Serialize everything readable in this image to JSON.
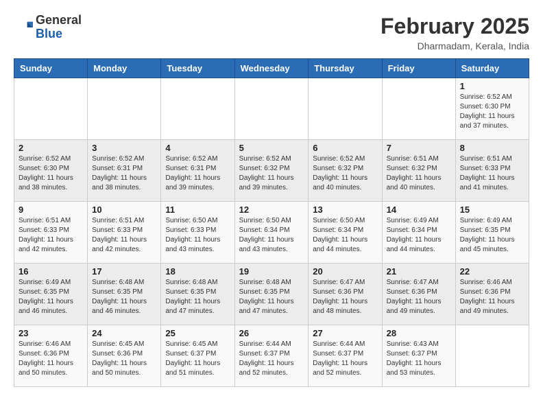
{
  "header": {
    "logo_general": "General",
    "logo_blue": "Blue",
    "month_year": "February 2025",
    "location": "Dharmadam, Kerala, India"
  },
  "days_of_week": [
    "Sunday",
    "Monday",
    "Tuesday",
    "Wednesday",
    "Thursday",
    "Friday",
    "Saturday"
  ],
  "weeks": [
    [
      {
        "day": "",
        "info": ""
      },
      {
        "day": "",
        "info": ""
      },
      {
        "day": "",
        "info": ""
      },
      {
        "day": "",
        "info": ""
      },
      {
        "day": "",
        "info": ""
      },
      {
        "day": "",
        "info": ""
      },
      {
        "day": "1",
        "info": "Sunrise: 6:52 AM\nSunset: 6:30 PM\nDaylight: 11 hours\nand 37 minutes."
      }
    ],
    [
      {
        "day": "2",
        "info": "Sunrise: 6:52 AM\nSunset: 6:30 PM\nDaylight: 11 hours\nand 38 minutes."
      },
      {
        "day": "3",
        "info": "Sunrise: 6:52 AM\nSunset: 6:31 PM\nDaylight: 11 hours\nand 38 minutes."
      },
      {
        "day": "4",
        "info": "Sunrise: 6:52 AM\nSunset: 6:31 PM\nDaylight: 11 hours\nand 39 minutes."
      },
      {
        "day": "5",
        "info": "Sunrise: 6:52 AM\nSunset: 6:32 PM\nDaylight: 11 hours\nand 39 minutes."
      },
      {
        "day": "6",
        "info": "Sunrise: 6:52 AM\nSunset: 6:32 PM\nDaylight: 11 hours\nand 40 minutes."
      },
      {
        "day": "7",
        "info": "Sunrise: 6:51 AM\nSunset: 6:32 PM\nDaylight: 11 hours\nand 40 minutes."
      },
      {
        "day": "8",
        "info": "Sunrise: 6:51 AM\nSunset: 6:33 PM\nDaylight: 11 hours\nand 41 minutes."
      }
    ],
    [
      {
        "day": "9",
        "info": "Sunrise: 6:51 AM\nSunset: 6:33 PM\nDaylight: 11 hours\nand 42 minutes."
      },
      {
        "day": "10",
        "info": "Sunrise: 6:51 AM\nSunset: 6:33 PM\nDaylight: 11 hours\nand 42 minutes."
      },
      {
        "day": "11",
        "info": "Sunrise: 6:50 AM\nSunset: 6:33 PM\nDaylight: 11 hours\nand 43 minutes."
      },
      {
        "day": "12",
        "info": "Sunrise: 6:50 AM\nSunset: 6:34 PM\nDaylight: 11 hours\nand 43 minutes."
      },
      {
        "day": "13",
        "info": "Sunrise: 6:50 AM\nSunset: 6:34 PM\nDaylight: 11 hours\nand 44 minutes."
      },
      {
        "day": "14",
        "info": "Sunrise: 6:49 AM\nSunset: 6:34 PM\nDaylight: 11 hours\nand 44 minutes."
      },
      {
        "day": "15",
        "info": "Sunrise: 6:49 AM\nSunset: 6:35 PM\nDaylight: 11 hours\nand 45 minutes."
      }
    ],
    [
      {
        "day": "16",
        "info": "Sunrise: 6:49 AM\nSunset: 6:35 PM\nDaylight: 11 hours\nand 46 minutes."
      },
      {
        "day": "17",
        "info": "Sunrise: 6:48 AM\nSunset: 6:35 PM\nDaylight: 11 hours\nand 46 minutes."
      },
      {
        "day": "18",
        "info": "Sunrise: 6:48 AM\nSunset: 6:35 PM\nDaylight: 11 hours\nand 47 minutes."
      },
      {
        "day": "19",
        "info": "Sunrise: 6:48 AM\nSunset: 6:35 PM\nDaylight: 11 hours\nand 47 minutes."
      },
      {
        "day": "20",
        "info": "Sunrise: 6:47 AM\nSunset: 6:36 PM\nDaylight: 11 hours\nand 48 minutes."
      },
      {
        "day": "21",
        "info": "Sunrise: 6:47 AM\nSunset: 6:36 PM\nDaylight: 11 hours\nand 49 minutes."
      },
      {
        "day": "22",
        "info": "Sunrise: 6:46 AM\nSunset: 6:36 PM\nDaylight: 11 hours\nand 49 minutes."
      }
    ],
    [
      {
        "day": "23",
        "info": "Sunrise: 6:46 AM\nSunset: 6:36 PM\nDaylight: 11 hours\nand 50 minutes."
      },
      {
        "day": "24",
        "info": "Sunrise: 6:45 AM\nSunset: 6:36 PM\nDaylight: 11 hours\nand 50 minutes."
      },
      {
        "day": "25",
        "info": "Sunrise: 6:45 AM\nSunset: 6:37 PM\nDaylight: 11 hours\nand 51 minutes."
      },
      {
        "day": "26",
        "info": "Sunrise: 6:44 AM\nSunset: 6:37 PM\nDaylight: 11 hours\nand 52 minutes."
      },
      {
        "day": "27",
        "info": "Sunrise: 6:44 AM\nSunset: 6:37 PM\nDaylight: 11 hours\nand 52 minutes."
      },
      {
        "day": "28",
        "info": "Sunrise: 6:43 AM\nSunset: 6:37 PM\nDaylight: 11 hours\nand 53 minutes."
      },
      {
        "day": "",
        "info": ""
      }
    ]
  ]
}
